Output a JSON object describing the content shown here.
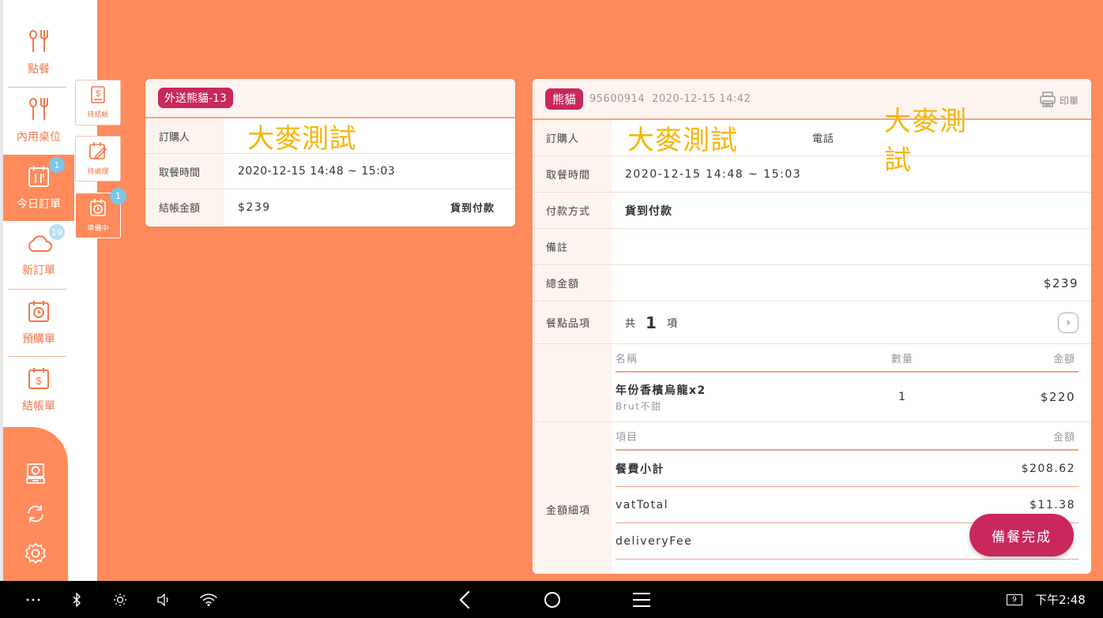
{
  "sidebar": {
    "items": [
      {
        "label": "點餐",
        "icon": "fork-knife-icon"
      },
      {
        "label": "內用桌位",
        "icon": "fork-knife-icon"
      },
      {
        "label": "今日訂單",
        "icon": "calendar-utensils-icon",
        "badge": "1"
      },
      {
        "label": "新訂單",
        "icon": "cloud-icon",
        "badge": "19"
      },
      {
        "label": "預購單",
        "icon": "calendar-clock-icon"
      },
      {
        "label": "結帳單",
        "icon": "calendar-dollar-icon"
      }
    ],
    "sub_items": [
      {
        "label": "待結帳",
        "icon": "receipt-dollar-icon"
      },
      {
        "label": "待處理",
        "icon": "calendar-edit-icon"
      },
      {
        "label": "準備中",
        "icon": "calendar-clock-icon",
        "badge": "1"
      }
    ],
    "tools": [
      "cash-drawer-icon",
      "sync-icon",
      "settings-icon"
    ]
  },
  "order_card": {
    "tag": "外送熊貓-13",
    "rows": [
      {
        "label": "訂購人",
        "value": "大麥測試"
      },
      {
        "label": "取餐時間",
        "value": "2020-12-15 14:48 ~ 15:03"
      },
      {
        "label": "結帳金額",
        "value": "$239",
        "extra": "貨到付款"
      }
    ]
  },
  "detail": {
    "tag": "熊貓",
    "order_no": "95600914",
    "created": "2020-12-15 14:42",
    "print_label": "印單",
    "buyer_label": "訂購人",
    "buyer": "大麥測試",
    "phone_label": "電話",
    "phone": "大麥測試",
    "pickup_label": "取餐時間",
    "pickup": "2020-12-15 14:48 ~ 15:03",
    "payment_label": "付款方式",
    "payment": "貨到付款",
    "note_label": "備註",
    "note": "",
    "total_label": "總金額",
    "total": "$239",
    "items_label": "餐點品項",
    "items_prefix": "共",
    "items_count": "1",
    "items_suffix": "項",
    "items_table": {
      "headers": [
        "名稱",
        "數量",
        "金額"
      ],
      "rows": [
        {
          "name": "年份香檳烏龍x2",
          "sub": "Brut不甜",
          "qty": "1",
          "amount": "$220"
        }
      ]
    },
    "breakdown_label": "金額細項",
    "breakdown": {
      "headers": [
        "項目",
        "金額"
      ],
      "rows": [
        {
          "item": "餐費小計",
          "amount": "$208.62"
        },
        {
          "item": "vatTotal",
          "amount": "$11.38"
        },
        {
          "item": "deliveryFee",
          "amount": ""
        }
      ]
    }
  },
  "fab_label": "備餐完成",
  "status_bar": {
    "time": "下午2:48",
    "notification_count": "9"
  }
}
